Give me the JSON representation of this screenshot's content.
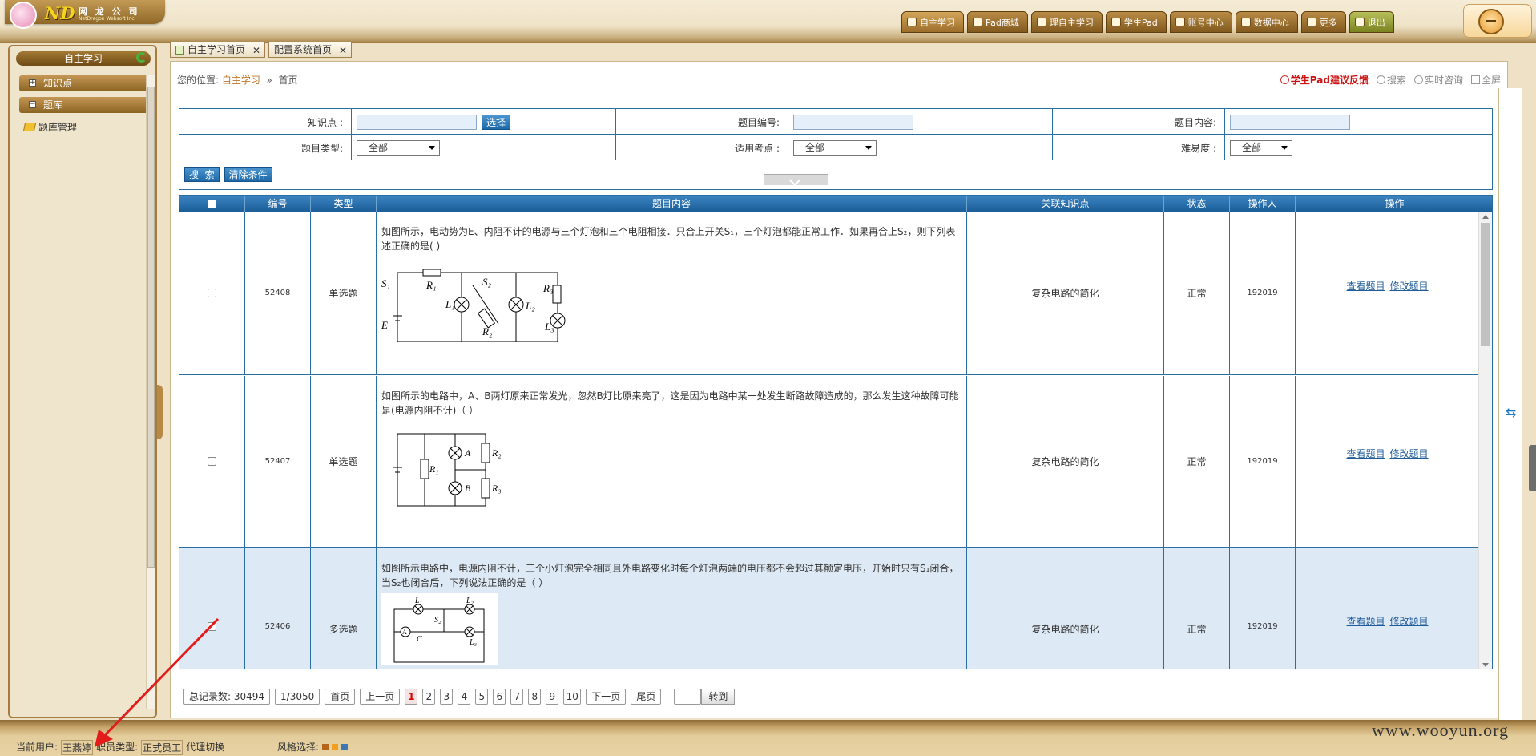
{
  "topbar": {
    "logo": {
      "abbr": "ND",
      "company_cn": "网 龙 公 司",
      "company_en": "NetDragon Websoft Inc."
    },
    "nav": [
      {
        "label": "自主学习",
        "icon": "book-icon",
        "active": true
      },
      {
        "label": "Pad商城",
        "icon": "store-icon"
      },
      {
        "label": "理自主学习",
        "icon": "book-icon"
      },
      {
        "label": "学生Pad",
        "icon": "tablet-icon"
      },
      {
        "label": "账号中心",
        "icon": "user-icon"
      },
      {
        "label": "数据中心",
        "icon": "database-icon"
      },
      {
        "label": "更多",
        "icon": "more-icon"
      },
      {
        "label": "退出",
        "icon": "exit-icon"
      }
    ]
  },
  "sidebar": {
    "title": "自主学习",
    "items": [
      {
        "label": "知识点",
        "toggle": "+"
      },
      {
        "label": "题库",
        "toggle": "−"
      }
    ],
    "subitem": "题库管理"
  },
  "tabs": [
    {
      "label": "自主学习首页"
    },
    {
      "label": "配置系统首页"
    }
  ],
  "breadcrumb": {
    "prefix": "您的位置:",
    "link": "自主学习",
    "sep": "»",
    "current": "首页"
  },
  "toplinks": {
    "feedback": "学生Pad建议反馈",
    "search": "搜索",
    "consult": "实时咨询",
    "fullscreen": "全屏"
  },
  "search": {
    "knowledge_label": "知识点 :",
    "select_btn": "选择",
    "qid_label": "题目编号:",
    "qcontent_label": "题目内容:",
    "qtype_label": "题目类型:",
    "qtype_value": "—全部—",
    "exam_label": "适用考点 :",
    "exam_value": "—全部—",
    "difficulty_label": "难易度 :",
    "difficulty_value": "—全部—",
    "search_btn": "搜  索",
    "clear_btn": "清除条件"
  },
  "table": {
    "headers": [
      "",
      "编号",
      "类型",
      "题目内容",
      "关联知识点",
      "状态",
      "操作人",
      "操作"
    ],
    "rows": [
      {
        "id": "52408",
        "type": "单选题",
        "content": "如图所示，电动势为E、内阻不计的电源与三个灯泡和三个电阻相接．只合上开关S₁，三个灯泡都能正常工作．如果再合上S₂，则下列表述正确的是(      )",
        "knowledge": "复杂电路的简化",
        "status": "正常",
        "operator": "192019",
        "view": "查看题目",
        "edit": "修改题目"
      },
      {
        "id": "52407",
        "type": "单选题",
        "content": "如图所示的电路中，A、B两灯原来正常发光，忽然B灯比原来亮了，这是因为电路中某一处发生断路故障造成的，那么发生这种故障可能是(电源内阻不计)（      ）",
        "knowledge": "复杂电路的简化",
        "status": "正常",
        "operator": "192019",
        "view": "查看题目",
        "edit": "修改题目"
      },
      {
        "id": "52406",
        "type": "多选题",
        "content": "如图所示电路中，电源内阻不计，三个小灯泡完全相同且外电路变化时每个灯泡两端的电压都不会超过其额定电压，开始时只有S₁闭合，当S₂也闭合后，下列说法正确的是（      ）",
        "knowledge": "复杂电路的简化",
        "status": "正常",
        "operator": "192019",
        "view": "查看题目",
        "edit": "修改题目"
      }
    ]
  },
  "pager": {
    "total": "总记录数: 30494",
    "pages": "1/3050",
    "first": "首页",
    "prev": "上一页",
    "numbers": [
      "1",
      "2",
      "3",
      "4",
      "5",
      "6",
      "7",
      "8",
      "9",
      "10"
    ],
    "current": "1",
    "next": "下一页",
    "last": "尾页",
    "go": "转到"
  },
  "status": {
    "user_label": "当前用户:",
    "user": "王燕婷",
    "role_label": "职员类型:",
    "role": "正式员工",
    "proxy": "代理切换",
    "style_label": "风格选择:",
    "style_colors": [
      "#b5651d",
      "#f0a020",
      "#3a78b5"
    ]
  },
  "watermark": "www.wooyun.org",
  "colors": {
    "accent": "#1b5e98",
    "brand": "#8c6422",
    "alert": "#cc1111"
  }
}
